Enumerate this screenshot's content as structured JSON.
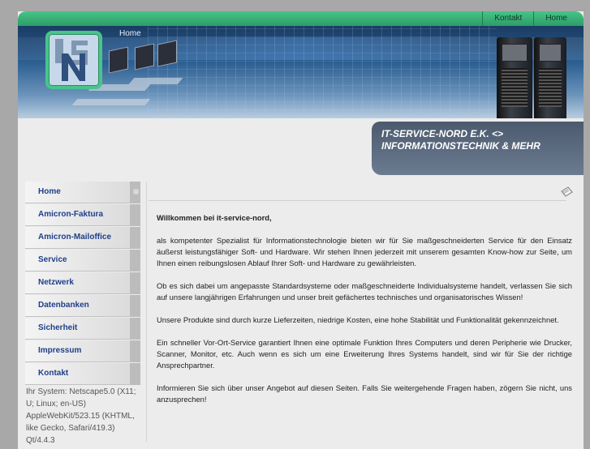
{
  "top_nav": {
    "items": [
      {
        "label": "Kontakt"
      },
      {
        "label": "Home"
      }
    ]
  },
  "banner": {
    "home_label": "Home"
  },
  "tagline": {
    "line1": "IT-SERVICE-NORD E.K. <>",
    "line2": "INFORMATIONSTECHNIK & MEHR"
  },
  "sidebar": {
    "items": [
      {
        "label": "Home"
      },
      {
        "label": "Amicron-Faktura"
      },
      {
        "label": "Amicron-Mailoffice"
      },
      {
        "label": "Service"
      },
      {
        "label": "Netzwerk"
      },
      {
        "label": "Datenbanken"
      },
      {
        "label": "Sicherheit"
      },
      {
        "label": "Impressum"
      },
      {
        "label": "Kontakt"
      }
    ],
    "system_info": "Ihr System: Netscape5.0 (X11; U; Linux; en-US) AppleWebKit/523.15 (KHTML, like Gecko, Safari/419.3) Qt/4.4.3"
  },
  "content": {
    "welcome": "Willkommen bei it-service-nord,",
    "paragraphs": [
      "als kompetenter Spezialist für Informationstechnologie bieten wir für Sie maßgeschneiderten Service für den Einsatz äußerst leistungsfähiger Soft- und Hardware. Wir stehen Ihnen jederzeit mit unserem gesamten Know-how zur Seite, um Ihnen einen reibungslosen Ablauf Ihrer Soft- und Hardware zu gewährleisten.",
      "Ob es sich dabei um angepasste Standardsysteme oder maßgeschneiderte Individualsysteme handelt, verlassen Sie sich auf unsere langjährigen Erfahrungen und unser breit gefächertes technisches und organisatorisches Wissen!",
      "Unsere Produkte sind durch kurze Lieferzeiten, niedrige Kosten, eine hohe Stabilität und Funktionalität gekennzeichnet.",
      "Ein schneller Vor-Ort-Service garantiert Ihnen eine optimale Funktion Ihres Computers und deren Peripherie wie Drucker, Scanner, Monitor, etc. Auch wenn es sich um eine Erweiterung Ihres Systems handelt, sind wir für Sie der richtige Ansprechpartner.",
      "Informieren Sie sich über unser Angebot auf diesen Seiten. Falls Sie weitergehende Fragen haben, zögern Sie nicht, uns anzusprechen!"
    ]
  },
  "colors": {
    "accent_green": "#46c489",
    "nav_text": "#1f3f8a",
    "tagline_box": "#5a6a80"
  },
  "icons": {
    "print": "print-icon"
  }
}
